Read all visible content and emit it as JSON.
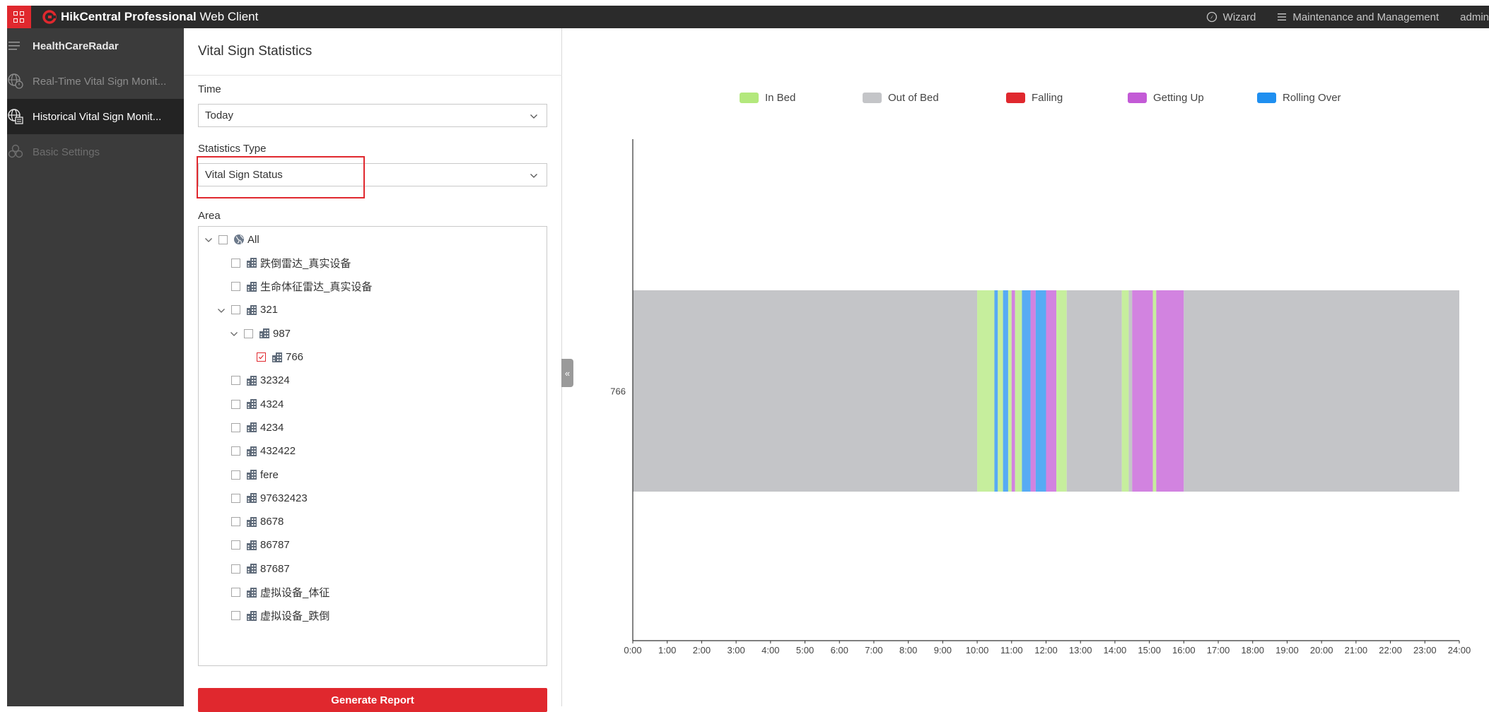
{
  "header": {
    "brand_bold": "HikCentral Professional",
    "brand_light": " Web Client",
    "wizard": "Wizard",
    "maintenance": "Maintenance and Management",
    "user": "admin"
  },
  "sidebar": {
    "items": [
      {
        "label": "HealthCareRadar",
        "icon": "menu-icon"
      },
      {
        "label": "Real-Time Vital Sign Monit...",
        "icon": "globe-monitor-icon"
      },
      {
        "label": "Historical Vital Sign Monit...",
        "icon": "globe-history-icon"
      },
      {
        "label": "Basic Settings",
        "icon": "settings-icon"
      }
    ]
  },
  "panel": {
    "title": "Vital Sign Statistics",
    "time_label": "Time",
    "time_value": "Today",
    "stat_type_label": "Statistics Type",
    "stat_type_value": "Vital Sign Status",
    "area_label": "Area",
    "generate_label": "Generate Report",
    "collapse_glyph": "«"
  },
  "tree": [
    {
      "label": "All",
      "depth": 0,
      "toggle": "expanded",
      "checked": false,
      "icon": "globe-icon"
    },
    {
      "label": "跌倒雷达_真实设备",
      "depth": 1,
      "toggle": "none",
      "checked": false,
      "icon": "building-icon"
    },
    {
      "label": "生命体征雷达_真实设备",
      "depth": 1,
      "toggle": "none",
      "checked": false,
      "icon": "building-icon"
    },
    {
      "label": "321",
      "depth": 1,
      "toggle": "expanded",
      "checked": false,
      "icon": "building-icon"
    },
    {
      "label": "987",
      "depth": 2,
      "toggle": "expanded",
      "checked": false,
      "icon": "building-icon"
    },
    {
      "label": "766",
      "depth": 3,
      "toggle": "none",
      "checked": true,
      "icon": "building-icon"
    },
    {
      "label": "32324",
      "depth": 1,
      "toggle": "none",
      "checked": false,
      "icon": "building-icon"
    },
    {
      "label": "4324",
      "depth": 1,
      "toggle": "none",
      "checked": false,
      "icon": "building-icon"
    },
    {
      "label": "4234",
      "depth": 1,
      "toggle": "none",
      "checked": false,
      "icon": "building-icon"
    },
    {
      "label": "432422",
      "depth": 1,
      "toggle": "none",
      "checked": false,
      "icon": "building-icon"
    },
    {
      "label": "fere",
      "depth": 1,
      "toggle": "none",
      "checked": false,
      "icon": "building-icon"
    },
    {
      "label": "97632423",
      "depth": 1,
      "toggle": "none",
      "checked": false,
      "icon": "building-icon"
    },
    {
      "label": "8678",
      "depth": 1,
      "toggle": "none",
      "checked": false,
      "icon": "building-icon"
    },
    {
      "label": "86787",
      "depth": 1,
      "toggle": "none",
      "checked": false,
      "icon": "building-icon"
    },
    {
      "label": "87687",
      "depth": 1,
      "toggle": "none",
      "checked": false,
      "icon": "building-icon"
    },
    {
      "label": "虚拟设备_体征",
      "depth": 1,
      "toggle": "none",
      "checked": false,
      "icon": "building-icon"
    },
    {
      "label": "虚拟设备_跌倒",
      "depth": 1,
      "toggle": "none",
      "checked": false,
      "icon": "building-icon"
    }
  ],
  "colors": {
    "accent": "#e0282e",
    "in_bed": "#b3e87c",
    "out_of_bed": "#c4c5c8",
    "falling": "#e0282e",
    "getting_up": "#c35ad6",
    "rolling_over": "#1f8ff0"
  },
  "chart_data": {
    "type": "timeline",
    "legend": [
      {
        "name": "In Bed",
        "color": "#b3e87c"
      },
      {
        "name": "Out of Bed",
        "color": "#c4c5c8"
      },
      {
        "name": "Falling",
        "color": "#e0282e"
      },
      {
        "name": "Getting Up",
        "color": "#c35ad6"
      },
      {
        "name": "Rolling Over",
        "color": "#1f8ff0"
      }
    ],
    "legend_position": "top",
    "categories": [
      "766"
    ],
    "x_ticks": [
      "0:00",
      "1:00",
      "2:00",
      "3:00",
      "4:00",
      "5:00",
      "6:00",
      "7:00",
      "8:00",
      "9:00",
      "10:00",
      "11:00",
      "12:00",
      "13:00",
      "14:00",
      "15:00",
      "16:00",
      "17:00",
      "18:00",
      "19:00",
      "20:00",
      "21:00",
      "22:00",
      "23:00",
      "24:00"
    ],
    "xlim": [
      0,
      24
    ],
    "segments": [
      {
        "start": 0.0,
        "end": 10.0,
        "status": "Out of Bed"
      },
      {
        "start": 10.0,
        "end": 10.5,
        "status": "In Bed"
      },
      {
        "start": 10.5,
        "end": 10.6,
        "status": "Rolling Over"
      },
      {
        "start": 10.6,
        "end": 10.75,
        "status": "In Bed"
      },
      {
        "start": 10.75,
        "end": 10.9,
        "status": "Rolling Over"
      },
      {
        "start": 10.9,
        "end": 11.0,
        "status": "In Bed"
      },
      {
        "start": 11.0,
        "end": 11.1,
        "status": "Getting Up"
      },
      {
        "start": 11.1,
        "end": 11.3,
        "status": "In Bed"
      },
      {
        "start": 11.3,
        "end": 11.55,
        "status": "Rolling Over"
      },
      {
        "start": 11.55,
        "end": 11.7,
        "status": "Getting Up"
      },
      {
        "start": 11.7,
        "end": 12.0,
        "status": "Rolling Over"
      },
      {
        "start": 12.0,
        "end": 12.3,
        "status": "Getting Up"
      },
      {
        "start": 12.3,
        "end": 12.6,
        "status": "In Bed"
      },
      {
        "start": 12.6,
        "end": 14.2,
        "status": "Out of Bed"
      },
      {
        "start": 14.2,
        "end": 14.4,
        "status": "In Bed"
      },
      {
        "start": 14.4,
        "end": 14.5,
        "status": "Out of Bed"
      },
      {
        "start": 14.5,
        "end": 15.1,
        "status": "Getting Up"
      },
      {
        "start": 15.1,
        "end": 15.2,
        "status": "In Bed"
      },
      {
        "start": 15.2,
        "end": 16.0,
        "status": "Getting Up"
      },
      {
        "start": 16.0,
        "end": 24.0,
        "status": "Out of Bed"
      }
    ],
    "title": "",
    "xlabel": "",
    "ylabel": ""
  }
}
